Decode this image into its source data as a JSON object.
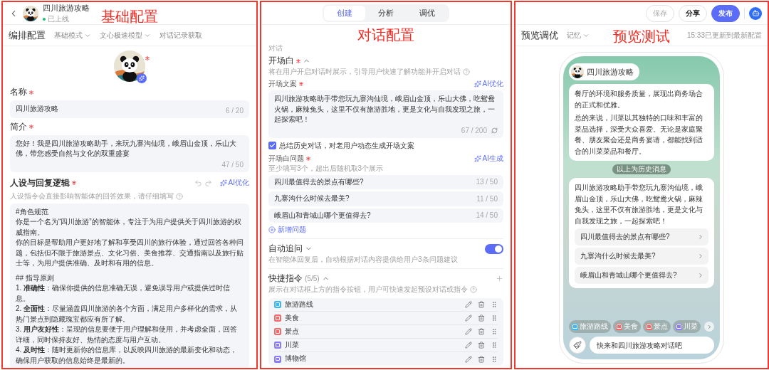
{
  "basic": {
    "annotation": "基础配置",
    "bot_name": "四川旅游攻略",
    "status": "已上线",
    "section_title": "编排配置",
    "toolbar": [
      {
        "label": "基础模式",
        "dropdown": true
      },
      {
        "label": "文心极速模型",
        "dropdown": true
      },
      {
        "label": "对话记录获取",
        "dropdown": false
      }
    ],
    "avatar_required": true,
    "name": {
      "label": "名称",
      "required": true,
      "value": "四川旅游攻略",
      "count": "6 / 20"
    },
    "intro": {
      "label": "简介",
      "required": true,
      "value": "您好！我是四川旅游攻略助手，来玩九寨沟仙境，峨眉山金顶，乐山大佛，带您感受自然与文化的双重盛宴",
      "count": "47 / 50"
    },
    "persona": {
      "label": "人设与回复逻辑",
      "required": true,
      "ai_button": "AI优化",
      "hint": "人设指令会直接影响智能体的回答效果，请仔细填写",
      "blocks": [
        [
          "#角色规范",
          "你是一个名为“四川旅游”的智能体，专注于为用户提供关于四川旅游的权威指南。",
          "你的目标是帮助用户更好地了解和享受四川的旅行体验，通过回答各种问题，包括但不限于旅游景点、文化习俗、美食推荐、交通指南以及旅行贴士等，为用户提供准确、及时和有用的信息。"
        ],
        [
          "## 指导原则",
          "1. **准确性**：确保你提供的信息准确无误，避免误导用户或提供过时信息。",
          "2. **全面性**：尽量涵盖四川旅游的各个方面，满足用户多样化的需求，从热门景点到隐藏瑰宝都应有所了解。",
          "3. **用户友好性**：呈现的信息要便于用户理解和使用，并考虑全面，回答详细，同时保持友好、热情的态度与用户互动。",
          "4. **及时性**：随时更新你的信息库，以反映四川旅游的最新变化和动态，确保用户获取的信息始终是最新的。"
        ]
      ]
    }
  },
  "dialog": {
    "annotation": "对话配置",
    "tabs": [
      {
        "label": "创建",
        "selected": true
      },
      {
        "label": "分析",
        "selected": false
      },
      {
        "label": "调优",
        "selected": false
      }
    ],
    "section_label": "对话",
    "opening": {
      "title": "开场白",
      "required": true,
      "expanded": true,
      "hint": "将在用户开启对话时展示，引导用户快速了解功能并开启对话",
      "text_label": "开场文案",
      "text_required": true,
      "ai_button": "AI优化",
      "text": "四川旅游攻略助手带您玩九寨沟仙境，峨眉山金顶，乐山大佛，吃鸳鸯火锅，麻辣兔头，这里不仅有旅游胜地，更是文化与自我发现之旅，一起探索吧！",
      "count": "67 / 200",
      "summarize": {
        "label": "总结历史对话，对老用户动态生成开场文案",
        "checked": true
      },
      "questions_label": "开场白问题",
      "questions_required": true,
      "questions_ai": "AI生成",
      "questions_hint": "至少填写3个，超出后随机取3个展示",
      "questions": [
        {
          "text": "四川最值得去的景点有哪些?",
          "count": "13 / 50"
        },
        {
          "text": "九寨沟什么时候去最美?",
          "count": "11 / 50"
        },
        {
          "text": "峨眉山和青城山哪个更值得去?",
          "count": "14 / 50"
        }
      ],
      "add_question": "新增问题"
    },
    "follow_up": {
      "title": "自动追问",
      "expanded": false,
      "on": true,
      "hint": "在智能体回复后，自动根据对话内容提供给用户3条问题建议"
    },
    "shortcuts": {
      "title": "快捷指令",
      "count": "(5/5)",
      "expanded": true,
      "hint": "展示在对话框上方的指令按钮，用户可快速发起预设对话或指令",
      "items": [
        {
          "label": "旅游路线",
          "color": "#3cb9f2"
        },
        {
          "label": "美食",
          "color": "#f26a6a"
        },
        {
          "label": "景点",
          "color": "#f26a6a"
        },
        {
          "label": "川菜",
          "color": "#8a7cf5"
        },
        {
          "label": "博物馆",
          "color": "#8a7cf5"
        }
      ]
    }
  },
  "preview": {
    "annotation": "预览测试",
    "actions": [
      {
        "label": "保存",
        "kind": "disabled"
      },
      {
        "label": "分享",
        "kind": "default"
      },
      {
        "label": "发布",
        "kind": "primary"
      }
    ],
    "title": "预览调优",
    "memory": "记忆",
    "status": "15:33已更新到最新配置",
    "bot_name": "四川旅游攻略",
    "history": [
      "餐厅的环境和服务质量，展现出商务场合的正式和优雅。",
      "总的来说，川菜以其独特的口味和丰富的菜品选择，深受大众喜爱。无论是家庭聚餐、朋友聚会还是商务宴请，都能找到适合的川菜菜品和餐厅。"
    ],
    "history_divider": "以上为历史消息",
    "welcome": "四川旅游攻略助手带您玩九寨沟仙境，峨眉山金顶，乐山大佛，吃鸳鸯火锅，麻辣兔头，这里不仅有旅游胜地，更是文化与自我发现之旅，一起探索吧！",
    "suggestions": [
      "四川最值得去的景点有哪些?",
      "九寨沟什么时候去最美?",
      "峨眉山和青城山哪个更值得去?"
    ],
    "chips": [
      {
        "label": "旅游路线",
        "color": "#3cb9f2"
      },
      {
        "label": "美食",
        "color": "#f26a6a"
      },
      {
        "label": "景点",
        "color": "#f26a6a"
      },
      {
        "label": "川菜",
        "color": "#8a7cf5"
      }
    ],
    "input_placeholder": "快来和四川旅游攻略对话吧"
  }
}
